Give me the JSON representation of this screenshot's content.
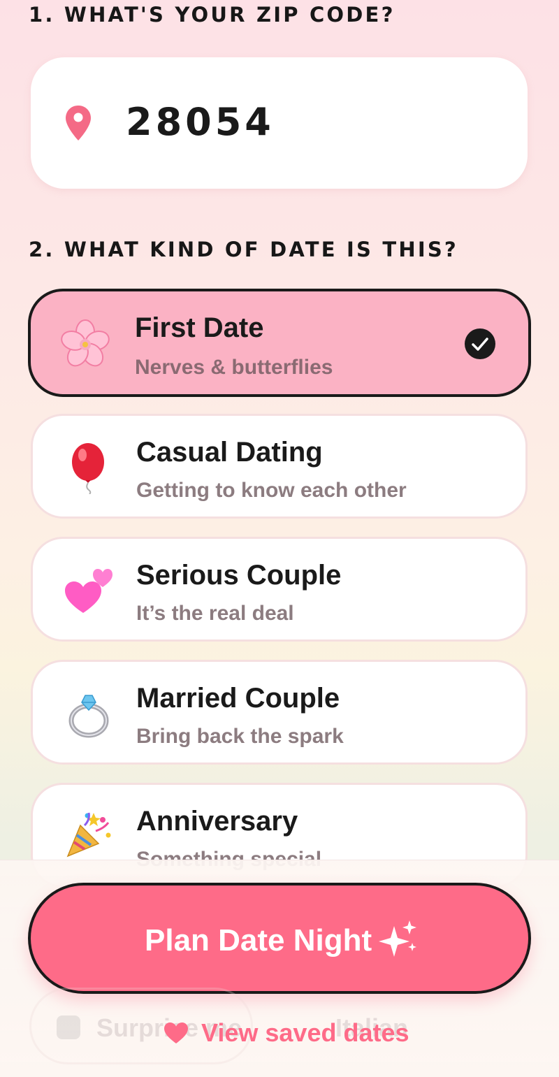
{
  "sections": {
    "zip_label": "1. WHAT'S YOUR ZIP CODE?",
    "kind_label": "2. WHAT KIND OF DATE IS THIS?"
  },
  "zip": {
    "value": "28054",
    "icon": "map-pin-icon"
  },
  "date_types": [
    {
      "title": "First Date",
      "subtitle": "Nerves & butterflies",
      "icon": "cherry-blossom-icon",
      "selected": true
    },
    {
      "title": "Casual Dating",
      "subtitle": "Getting to know each other",
      "icon": "balloon-icon",
      "selected": false
    },
    {
      "title": "Serious Couple",
      "subtitle": "It’s the real deal",
      "icon": "two-hearts-icon",
      "selected": false
    },
    {
      "title": "Married Couple",
      "subtitle": "Bring back the spark",
      "icon": "ring-icon",
      "selected": false
    },
    {
      "title": "Anniversary",
      "subtitle": "Something special",
      "icon": "party-popper-icon",
      "selected": false
    }
  ],
  "actions": {
    "plan_label": "Plan Date Night",
    "plan_icon": "sparkles-icon",
    "surprise_label": "Surprise me",
    "cuisine_label": "Italian",
    "saved_label": "View saved dates",
    "saved_icon": "heart-icon"
  },
  "colors": {
    "accent": "#fe6b88",
    "selected_fill": "#fbb2c4",
    "border_dark": "#1a1a1a",
    "subtitle": "#8c7c80"
  }
}
